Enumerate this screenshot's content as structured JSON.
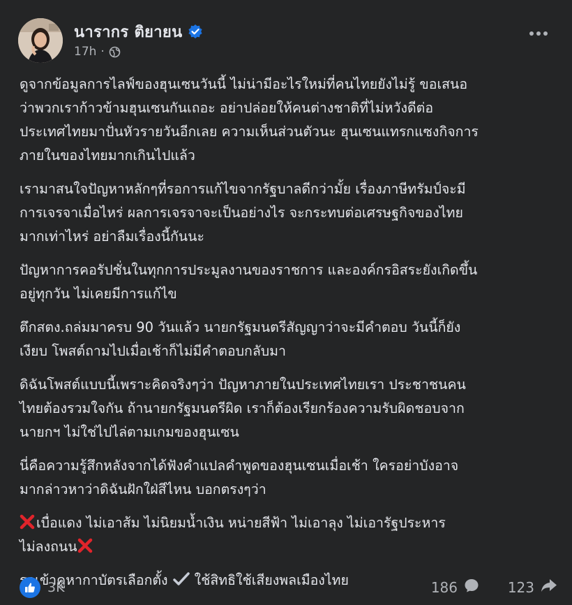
{
  "post": {
    "author_name": "นารากร ติยายน",
    "timestamp": "17h",
    "meta_separator": "·",
    "paragraphs": [
      "ดูจากข้อมูลการไลฟ์ของฮุนเซนวันนี้ ไม่น่ามีอะไรใหม่ที่คนไทยยังไม่รู้ ขอเสนอ\nว่าพวกเราก้าวข้ามฮุนเซนกันเถอะ  อย่าปล่อยให้คนต่างชาติที่ไม่หวังดีต่อ\nประเทศไทยมาปั่นหัวรายวันอีกเลย ความเห็นส่วนตัวนะ ฮุนเซนแทรกแซงกิจการ\nภายในของไทยมากเกินไปแล้ว",
      "เรามาสนใจปัญหาหลักๆที่รอการแก้ไขจากรัฐบาลดีกว่ามั้ย เรื่องภาษีทรัมป์จะมี\nการเจรจาเมื่อไหร่  ผลการเจรจาจะเป็นอย่างไร จะกระทบต่อเศรษฐกิจของไทย\nมากเท่าไหร่  อย่าลืมเรื่องนี้กันนะ",
      "ปัญหาการคอรัปชั่นในทุกการประมูลงานของราชการ และองค์กรอิสระยังเกิดขึ้น\nอยู่ทุกวัน ไม่เคยมีการแก้ไข",
      "ตึกสตง.ถล่มมาครบ 90 วันแล้ว นายกรัฐมนตรีสัญญาว่าจะมีคำตอบ วันนี้ก็ยัง\nเงียบ โพสต์ถามไปเมื่อเช้าก็ไม่มีคำตอบกลับมา",
      "ดิฉันโพสต์แบบนี้เพราะคิดจริงๆว่า ปัญหาภายในประเทศไทยเรา ประชาชนคน\nไทยต้องรวมใจกัน  ถ้านายกรัฐมนตรีผิด เราก็ต้องเรียกร้องความรับผิดชอบจาก\nนายกฯ  ไม่ใช่ไปไล่ตามเกมของฮุนเซน",
      "นี่คือความรู้สึกหลังจากได้ฟังคำแปลคำพูดของฮุนเซนเมื่อเช้า  ใครอย่าบังอาจ\nมากล่าวหาว่าดิฉันฝักใฝ่สีไหน  บอกตรงๆว่า"
    ],
    "colors_line_part1": "เบื่อแดง  ไม่เอาส้ม  ไม่นิยมน้ำเงิน  หน่ายสีฟ้า  ไม่เอาลุง  ไม่เอารัฐประหาร",
    "colors_line_part2": "ไม่ลงถนน",
    "vote_line_part1": "รอเข้าคูหากาบัตรเลือกตั้ง",
    "vote_line_part2": "ใช้สิทธิใช้เสียงพลเมืองไทย"
  },
  "reactions": {
    "like_count": "3K",
    "comment_count": "186",
    "share_count": "123"
  },
  "icons": {
    "verified": "verified-badge-icon",
    "audience": "globe-icon",
    "more": "more-options-icon",
    "cross": "cross-mark-icon",
    "check": "check-mark-icon",
    "like": "thumbs-up-icon",
    "comment": "comment-icon",
    "share": "share-icon"
  },
  "colors": {
    "background": "#242526",
    "text": "#e4e6eb",
    "secondary_text": "#b0b3b8",
    "accent_blue": "#1b74e4",
    "cross_red": "#e0242b"
  }
}
